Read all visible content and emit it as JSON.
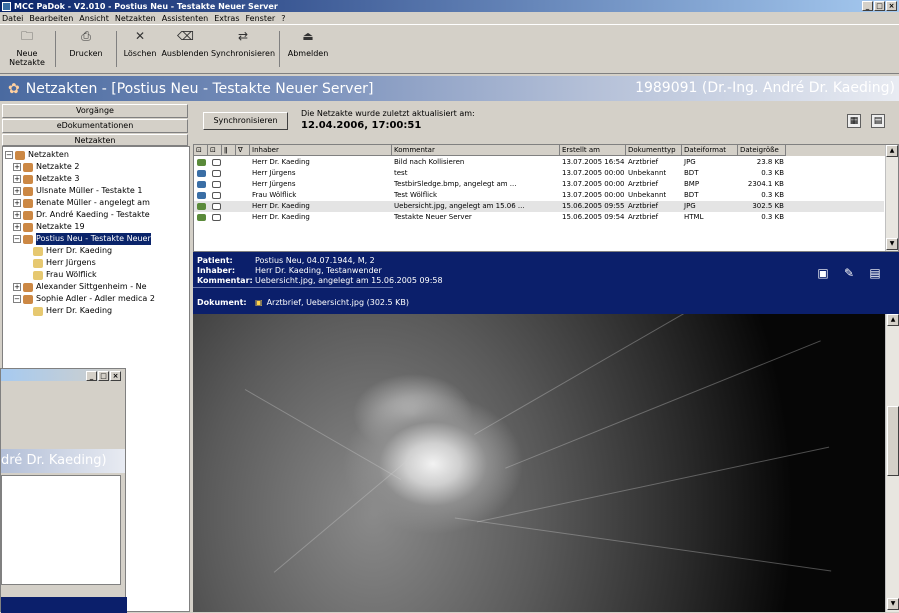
{
  "window": {
    "title": "MCC PaDok - V2.010 - Postius Neu - Testakte Neuer Server"
  },
  "menu": [
    "Datei",
    "Bearbeiten",
    "Ansicht",
    "Netzakten",
    "Assistenten",
    "Extras",
    "Fenster",
    "?"
  ],
  "toolbar": [
    {
      "label": "Neue Netzakte",
      "icon": "new-folder-icon"
    },
    {
      "label": "Drucken",
      "icon": "print-icon"
    },
    {
      "label": "Löschen",
      "icon": "delete-icon"
    },
    {
      "label": "Ausblenden",
      "icon": "hide-icon"
    },
    {
      "label": "Synchronisieren",
      "icon": "sync-icon"
    },
    {
      "label": "Abmelden",
      "icon": "logout-icon"
    }
  ],
  "header": {
    "title": "Netzakten - [Postius Neu - Testakte Neuer Server]",
    "user": "1989091 (Dr.-Ing. André Dr. Kaeding)"
  },
  "left": {
    "btn_vorgaenge": "Vorgänge",
    "btn_edok": "eDokumentationen",
    "btn_netzakten": "Netzakten",
    "tree": [
      {
        "label": "Netzakten",
        "level": 0,
        "pm": "-"
      },
      {
        "label": "Netzakte 2",
        "level": 1,
        "pm": "+"
      },
      {
        "label": "Netzakte 3",
        "level": 1,
        "pm": "+"
      },
      {
        "label": "Ulsnate Müller - Testakte 1",
        "level": 1,
        "pm": "+"
      },
      {
        "label": "Renate Müller - angelegt am",
        "level": 1,
        "pm": "+"
      },
      {
        "label": "Dr. André Kaeding - Testakte",
        "level": 1,
        "pm": "+"
      },
      {
        "label": "Netzakte 19",
        "level": 1,
        "pm": "+"
      },
      {
        "label": "Postius Neu - Testakte Neuer",
        "level": 1,
        "pm": "-",
        "selected": true
      },
      {
        "label": "Herr Dr. Kaeding",
        "level": 2,
        "pm": ""
      },
      {
        "label": "Herr Jürgens",
        "level": 2,
        "pm": ""
      },
      {
        "label": "Frau Wölflick",
        "level": 2,
        "pm": ""
      },
      {
        "label": "Alexander Sittgenheim - Ne",
        "level": 1,
        "pm": "+"
      },
      {
        "label": "Sophie Adler - Adler medica 2",
        "level": 1,
        "pm": "-"
      },
      {
        "label": "Herr Dr. Kaeding",
        "level": 2,
        "pm": ""
      }
    ]
  },
  "sync": {
    "button": "Synchronisieren",
    "info": "Die Netzakte wurde zuletzt aktualisiert am:",
    "date": "12.04.2006, 17:00:51"
  },
  "table": {
    "columns": [
      "Inhaber",
      "Kommentar",
      "Erstellt am",
      "Dokumenttyp",
      "Dateiformat",
      "Dateigröße"
    ],
    "rows": [
      [
        "Herr Dr. Kaeding",
        "Bild nach Kollisieren",
        "13.07.2005 16:54",
        "Arztbrief",
        "JPG",
        "23.8 KB"
      ],
      [
        "Herr Jürgens",
        "test",
        "13.07.2005 00:00",
        "Unbekannt",
        "BDT",
        "0.3 KB"
      ],
      [
        "Herr Jürgens",
        "TestbirSledge.bmp, angelegt am ...",
        "13.07.2005 00:00",
        "Arztbrief",
        "BMP",
        "2304.1 KB"
      ],
      [
        "Frau Wölflick",
        "Test Wölflick",
        "13.07.2005 00:00",
        "Unbekannt",
        "BDT",
        "0.3 KB"
      ],
      [
        "Herr Dr. Kaeding",
        "Uebersicht.jpg, angelegt am 15.06 ...",
        "15.06.2005 09:55",
        "Arztbrief",
        "JPG",
        "302.5 KB"
      ],
      [
        "Herr Dr. Kaeding",
        "Testakte Neuer Server",
        "15.06.2005 09:54",
        "Arztbrief",
        "HTML",
        "0.3 KB"
      ]
    ]
  },
  "info": {
    "patient_label": "Patient:",
    "patient": "Postius Neu, 04.07.1944, M, 2",
    "owner_label": "Inhaber:",
    "owner": "Herr Dr. Kaeding, Testanwender",
    "comment_label": "Kommentar:",
    "comment": "Uebersicht.jpg, angelegt am 15.06.2005 09:58",
    "doc_label": "Dokument:",
    "doc": "Arztbrief, Uebersicht.jpg (302.5 KB)"
  },
  "ghost": {
    "header": "dré Dr. Kaeding)"
  }
}
